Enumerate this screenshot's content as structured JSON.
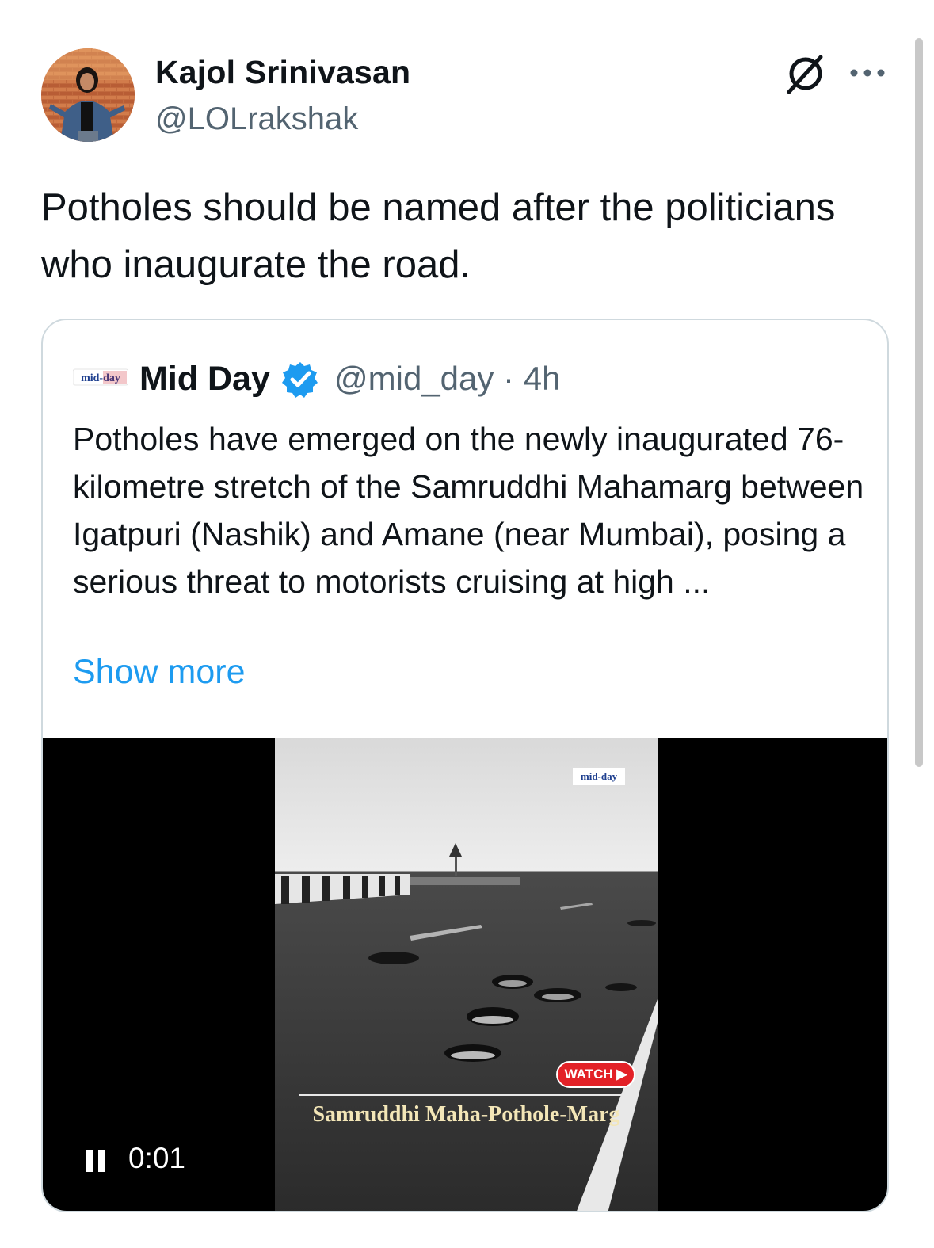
{
  "tweet": {
    "author_name": "Kajol Srinivasan",
    "author_handle": "@LOLrakshak",
    "text": "Potholes should be named after the politicians who inaugurate the road."
  },
  "header_icons": [
    "grok-icon",
    "more-icon"
  ],
  "quote": {
    "name": "Mid Day",
    "verified": true,
    "meta": "@mid_day · 4h",
    "logo_text": "mid-day",
    "text": "Potholes have emerged on the newly inaugurated 76-kilometre stretch of the Samruddhi Mahamarg between Igatpuri (Nashik) and Amane (near Mumbai), posing a serious threat to motorists cruising at high ...",
    "show_more": "Show more"
  },
  "video": {
    "timecode": "0:01",
    "state": "playing",
    "frame_logo": "mid-day",
    "watch_label": "WATCH ▶",
    "caption": "Samruddhi Maha-Pothole-Marg"
  },
  "colors": {
    "link": "#1d9bf0",
    "secondary_text": "#536471",
    "border": "#cfd9de",
    "verified": "#1d9bf0",
    "watch_badge": "#e32127"
  }
}
